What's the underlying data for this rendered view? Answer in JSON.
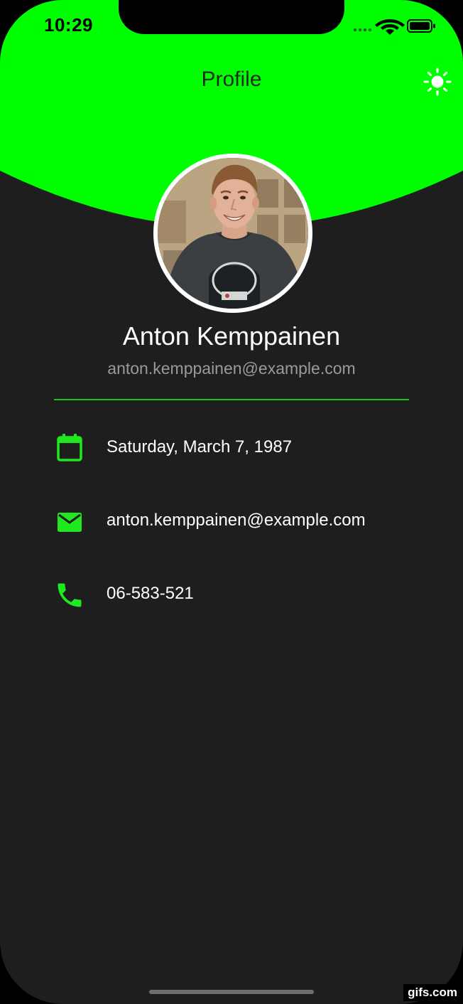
{
  "status_bar": {
    "time": "10:29"
  },
  "header": {
    "title": "Profile",
    "toggle_icon": "sun-icon"
  },
  "profile": {
    "name": "Anton Kemppainen",
    "email": "anton.kemppainen@example.com",
    "avatar": "profile-photo"
  },
  "details": [
    {
      "icon": "calendar-icon",
      "text": "Saturday, March 7, 1987"
    },
    {
      "icon": "email-icon",
      "text": "anton.kemppainen@example.com"
    },
    {
      "icon": "phone-icon",
      "text": "06-583-521"
    }
  ],
  "watermark": "gifs.com",
  "colors": {
    "accent": "#00ff00",
    "background": "#1e1e1e",
    "icon": "#1fe81f",
    "divider": "#1fbf1f",
    "secondary_text": "#9a9a9a"
  }
}
